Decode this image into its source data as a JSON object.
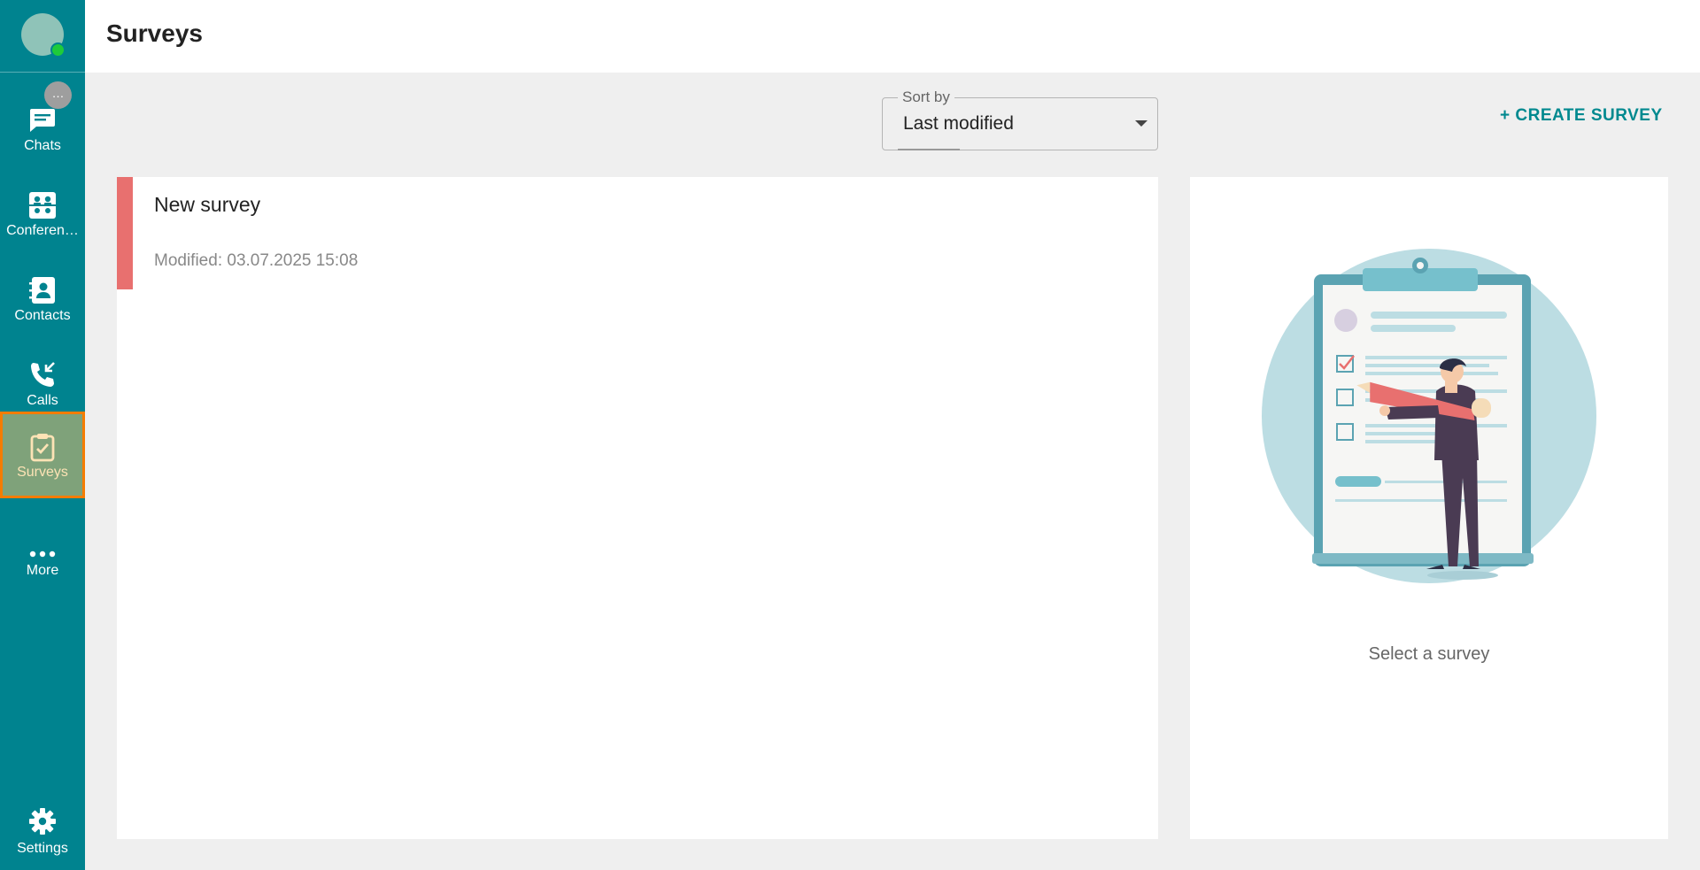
{
  "sidebar": {
    "items": [
      {
        "label": "Chats",
        "icon": "chat-icon"
      },
      {
        "label": "Conferen…",
        "icon": "conference-icon"
      },
      {
        "label": "Contacts",
        "icon": "contacts-icon"
      },
      {
        "label": "Calls",
        "icon": "calls-icon"
      },
      {
        "label": "Surveys",
        "icon": "survey-clipboard-icon"
      },
      {
        "label": "More",
        "icon": "more-dots-icon"
      },
      {
        "label": "Settings",
        "icon": "gear-icon"
      }
    ],
    "chats_badge": "…",
    "active_index": 4
  },
  "header": {
    "title": "Surveys"
  },
  "sort": {
    "label": "Sort by",
    "value": "Last modified"
  },
  "create_button": "+ CREATE SURVEY",
  "surveys": [
    {
      "name": "New survey",
      "modified": "Modified: 03.07.2025 15:08"
    }
  ],
  "detail": {
    "placeholder": "Select a survey"
  },
  "colors": {
    "sidebar": "#00838f",
    "accent": "#00898f",
    "active_border": "#f57c00",
    "survey_stripe": "#e8706f",
    "presence": "#1ecb3a"
  }
}
